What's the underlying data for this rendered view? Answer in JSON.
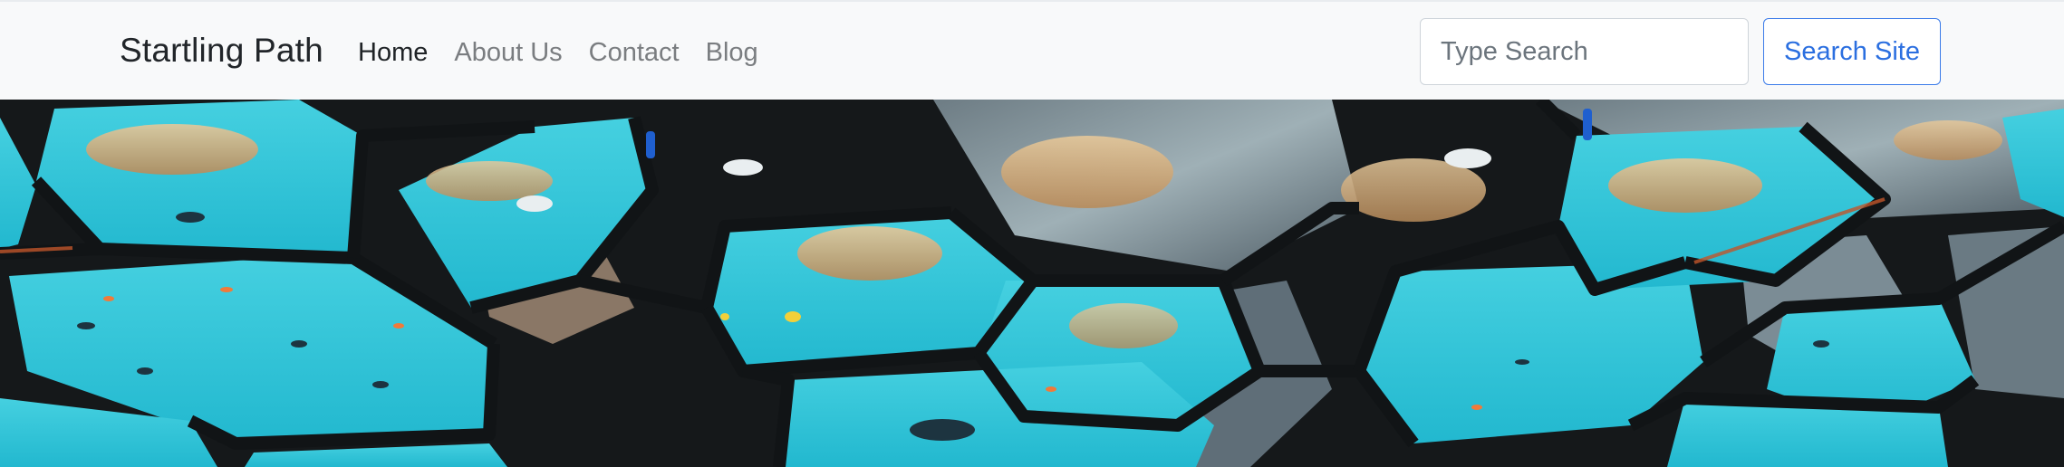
{
  "navbar": {
    "brand": "Startling Path",
    "links": [
      {
        "label": "Home",
        "active": true
      },
      {
        "label": "About Us",
        "active": false
      },
      {
        "label": "Contact",
        "active": false
      },
      {
        "label": "Blog",
        "active": false
      }
    ],
    "search": {
      "placeholder": "Type Search",
      "value": "",
      "button_label": "Search Site"
    }
  },
  "colors": {
    "navbar_bg": "#f8f9fa",
    "brand_text": "#212529",
    "link_active": "#1f2326",
    "link_inactive": "#7a7d80",
    "button_accent": "#2b6fe0",
    "aquarium_water": "#2bbfd3",
    "frame_dark": "#15181a"
  },
  "hero": {
    "image_subject": "aquarium-mirror-ceiling-photo"
  }
}
